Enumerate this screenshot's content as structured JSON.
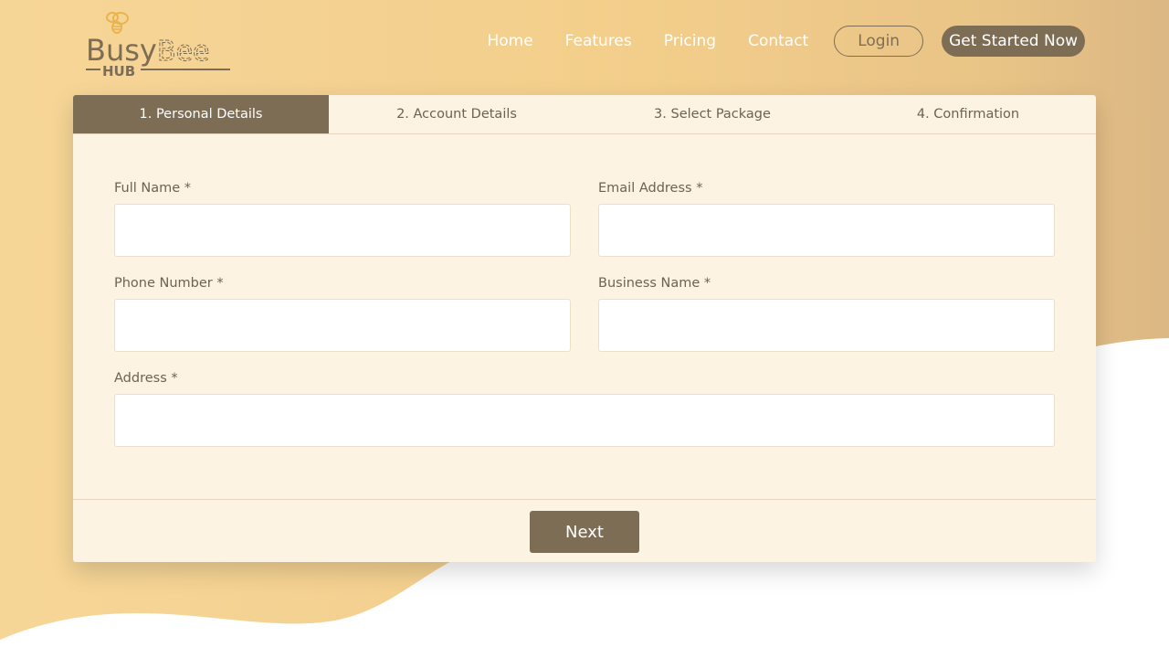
{
  "brand": {
    "name_part1": "Busy",
    "name_part2": "Bee",
    "name_sub": "HUB",
    "colors": {
      "primary": "#7e6d55",
      "background": "#f4cc86",
      "card": "#fdf3e2"
    }
  },
  "nav": {
    "links": [
      "Home",
      "Features",
      "Pricing",
      "Contact"
    ],
    "login_label": "Login",
    "cta_label": "Get Started Now"
  },
  "steps": [
    {
      "label": "1. Personal Details",
      "active": true
    },
    {
      "label": "2. Account Details",
      "active": false
    },
    {
      "label": "3. Select Package",
      "active": false
    },
    {
      "label": "4. Confirmation",
      "active": false
    }
  ],
  "form": {
    "full_name": {
      "label": "Full Name *",
      "value": ""
    },
    "email": {
      "label": "Email Address *",
      "value": ""
    },
    "phone": {
      "label": "Phone Number *",
      "value": ""
    },
    "business": {
      "label": "Business Name *",
      "value": ""
    },
    "address": {
      "label": "Address *",
      "value": ""
    }
  },
  "footer": {
    "next_label": "Next"
  },
  "icons": {
    "logo": "bee-logo-icon"
  }
}
